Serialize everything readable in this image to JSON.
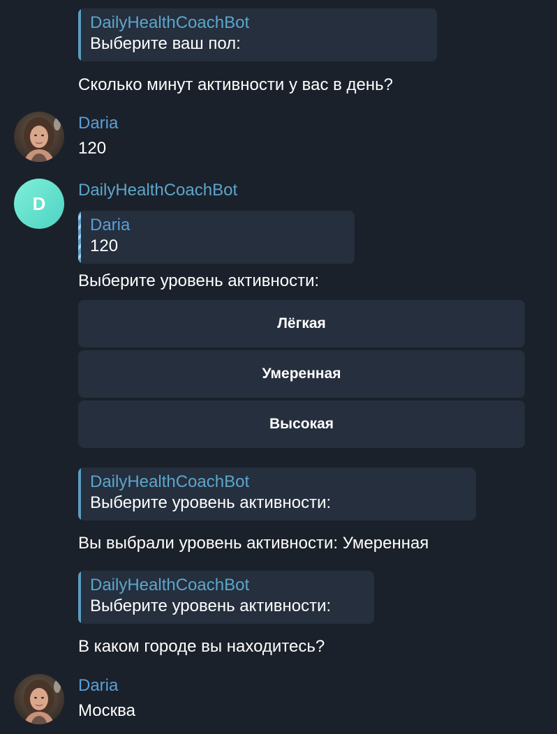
{
  "bot_name": "DailyHealthCoachBot",
  "user_name": "Daria",
  "bot_avatar_letter": "D",
  "colors": {
    "background": "#1b212a",
    "quote_background": "#252f3d",
    "button_background": "#262f3d",
    "bot_name_color": "#5ca6cc",
    "user_name_color": "#5b9fd8",
    "bot_avatar_gradient": [
      "#7ef0d8",
      "#4fd2c4"
    ]
  },
  "messages": {
    "m1": {
      "reply_to": {
        "author": "DailyHealthCoachBot",
        "text": "Выберите ваш пол:"
      },
      "text": "Сколько минут активности у вас в день?"
    },
    "m2": {
      "sender": "Daria",
      "text": "120",
      "avatar_icon": "user-photo-icon"
    },
    "m3": {
      "sender": "DailyHealthCoachBot",
      "avatar_icon": "bot-avatar-icon",
      "reply_to": {
        "author": "Daria",
        "text": "120"
      },
      "text": "Выберите уровень активности:",
      "buttons": [
        "Лёгкая",
        "Умеренная",
        "Высокая"
      ]
    },
    "m4": {
      "reply_to": {
        "author": "DailyHealthCoachBot",
        "text": "Выберите уровень активности:"
      },
      "text": "Вы выбрали уровень активности: Умеренная"
    },
    "m5": {
      "reply_to": {
        "author": "DailyHealthCoachBot",
        "text": "Выберите уровень активности:"
      },
      "text": "В каком городе вы находитесь?"
    },
    "m6": {
      "sender": "Daria",
      "text": "Москва",
      "avatar_icon": "user-photo-icon"
    }
  }
}
